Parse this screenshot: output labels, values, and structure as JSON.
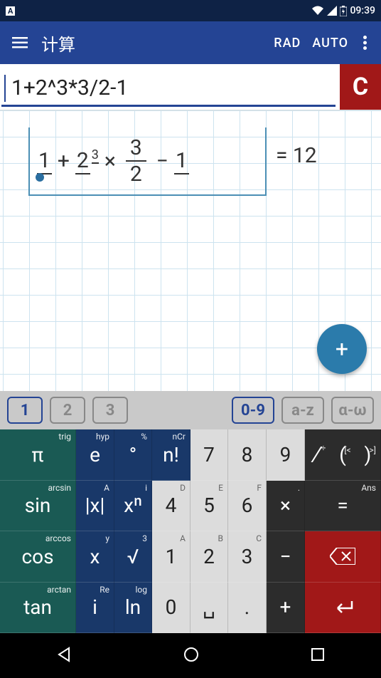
{
  "status": {
    "time": "09:39"
  },
  "appbar": {
    "title": "计算",
    "rad": "RAD",
    "auto": "AUTO"
  },
  "input": {
    "expression": "1+2^3*3/2-1",
    "clear": "C"
  },
  "equation": {
    "a": "1",
    "op1": "+",
    "b": "2",
    "exp": "3",
    "op2": "×",
    "fnum": "3",
    "fden": "2",
    "op3": "−",
    "c": "1",
    "eq": "= 12"
  },
  "fab": {
    "label": "+"
  },
  "chips": {
    "c1": "1",
    "c2": "2",
    "c3": "3",
    "num": "0-9",
    "alpha": "a-z",
    "greek": "α-ω"
  },
  "keys": {
    "r1": {
      "k1": "π",
      "k1s": "trig",
      "k2": "e",
      "k2s": "hyp",
      "k3": "°",
      "k3s": "%",
      "k4": "n!",
      "k4s": "nCr",
      "k5": "7",
      "k6": "8",
      "k7": "9",
      "k8": "∕",
      "k8s": "÷",
      "k9": "(",
      "k9s": "[<",
      "k10": ")",
      "k10s": ">]"
    },
    "r2": {
      "k1": "sin",
      "k1s": "arcsin",
      "k2": "|x|",
      "k2s": "A",
      "k3": "xⁿ",
      "k3s": "i",
      "k4": "4",
      "k4s": "D",
      "k5": "5",
      "k5s": "E",
      "k6": "6",
      "k6s": "F",
      "k7": "×",
      "k7s": ".",
      "k8": "=",
      "k8s": "Ans"
    },
    "r3": {
      "k1": "cos",
      "k1s": "arccos",
      "k2": "x",
      "k2s": "y",
      "k3": "√",
      "k3s": "3",
      "k4": "1",
      "k4s": "A",
      "k5": "2",
      "k5s": "B",
      "k6": "3",
      "k6s": "C",
      "k7": "−",
      "k8": "⌫"
    },
    "r4": {
      "k1": "tan",
      "k1s": "arctan",
      "k2": "i",
      "k2s": "Re",
      "k3": "ln",
      "k3s": "log",
      "k4": "0",
      "k5": "␣",
      "k6": ".",
      "k7": "+",
      "k8": "↵"
    }
  }
}
